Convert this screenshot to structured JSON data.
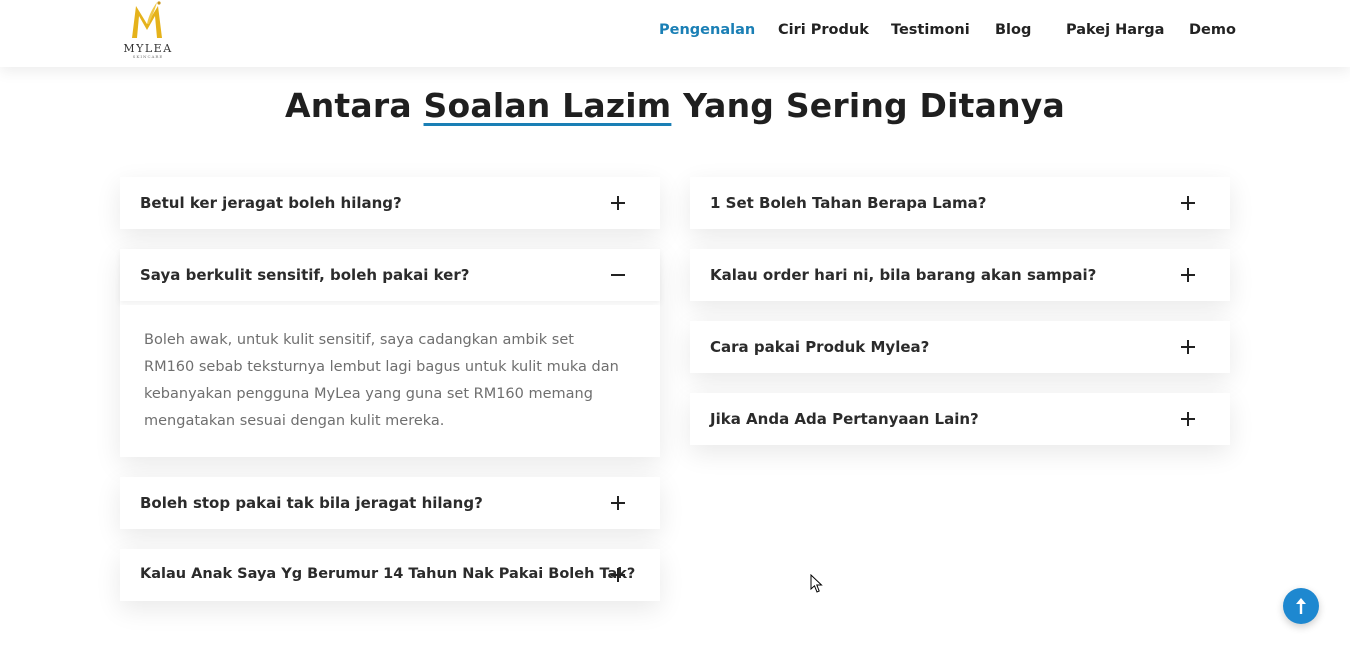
{
  "header": {
    "logo": {
      "brand": "MYLEA",
      "sub": "SKINCARE"
    },
    "nav": [
      {
        "label": "Pengenalan",
        "active": true
      },
      {
        "label": "Ciri Produk",
        "active": false
      },
      {
        "label": "Testimoni",
        "active": false
      },
      {
        "label": "Blog",
        "active": false
      },
      {
        "label": "Pakej Harga",
        "active": false
      },
      {
        "label": "Demo",
        "active": false
      }
    ]
  },
  "faq": {
    "title_prefix": "Antara ",
    "title_highlight": "Soalan Lazim",
    "title_suffix": " Yang Sering Ditanya",
    "left": [
      {
        "question": "Betul ker jeragat boleh hilang?",
        "expanded": false
      },
      {
        "question": "Saya berkulit sensitif, boleh pakai ker?",
        "expanded": true,
        "answer": "Boleh awak, untuk kulit sensitif, saya cadangkan ambik set RM160 sebab teksturnya lembut lagi bagus untuk kulit muka dan kebanyakan pengguna MyLea yang guna set RM160 memang mengatakan sesuai dengan kulit mereka."
      },
      {
        "question": "Boleh stop pakai tak bila jeragat hilang?",
        "expanded": false
      },
      {
        "question": "Kalau Anak Saya Yg Berumur 14 Tahun Nak Pakai Boleh Tak?",
        "expanded": false
      }
    ],
    "right": [
      {
        "question": "1 Set Boleh Tahan Berapa Lama?",
        "expanded": false
      },
      {
        "question": "Kalau order hari ni, bila barang akan sampai?",
        "expanded": false
      },
      {
        "question": "Cara pakai Produk Mylea?",
        "expanded": false
      },
      {
        "question": "Jika Anda Ada Pertanyaan Lain?",
        "expanded": false
      }
    ]
  },
  "colors": {
    "accent": "#1a7fb5",
    "logo_gold": "#e5b21b",
    "back_to_top": "#1e88d0"
  },
  "icons": {
    "expand": "plus-icon",
    "collapse": "minus-icon",
    "back_to_top": "arrow-up-icon"
  }
}
